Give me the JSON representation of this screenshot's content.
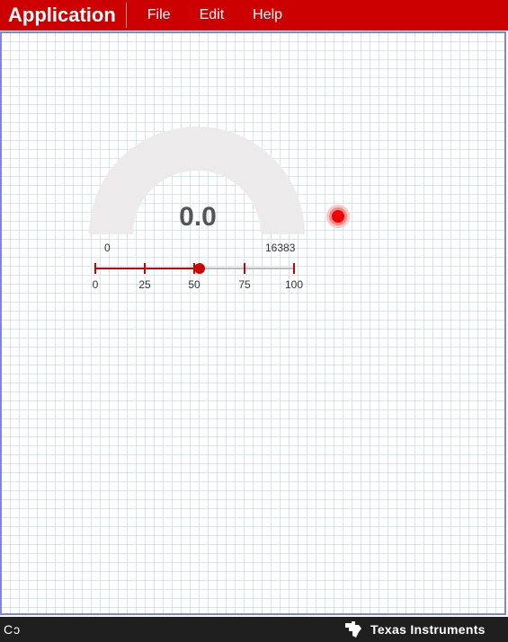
{
  "header": {
    "title": "Application",
    "menu": [
      "File",
      "Edit",
      "Help"
    ],
    "bg_color": "#cc0000"
  },
  "gauge": {
    "value": "0.0",
    "min": "0",
    "max": "16383",
    "track_color": "#eceaea"
  },
  "slider": {
    "value_percent": 50,
    "ticks": [
      "0",
      "25",
      "50",
      "75",
      "100"
    ],
    "active_color": "#cc0000",
    "inactive_color": "#bbbbbb"
  },
  "led": {
    "color": "#ee0000"
  },
  "footer": {
    "left_text": "Cↄ",
    "brand": "Texas Instruments"
  }
}
